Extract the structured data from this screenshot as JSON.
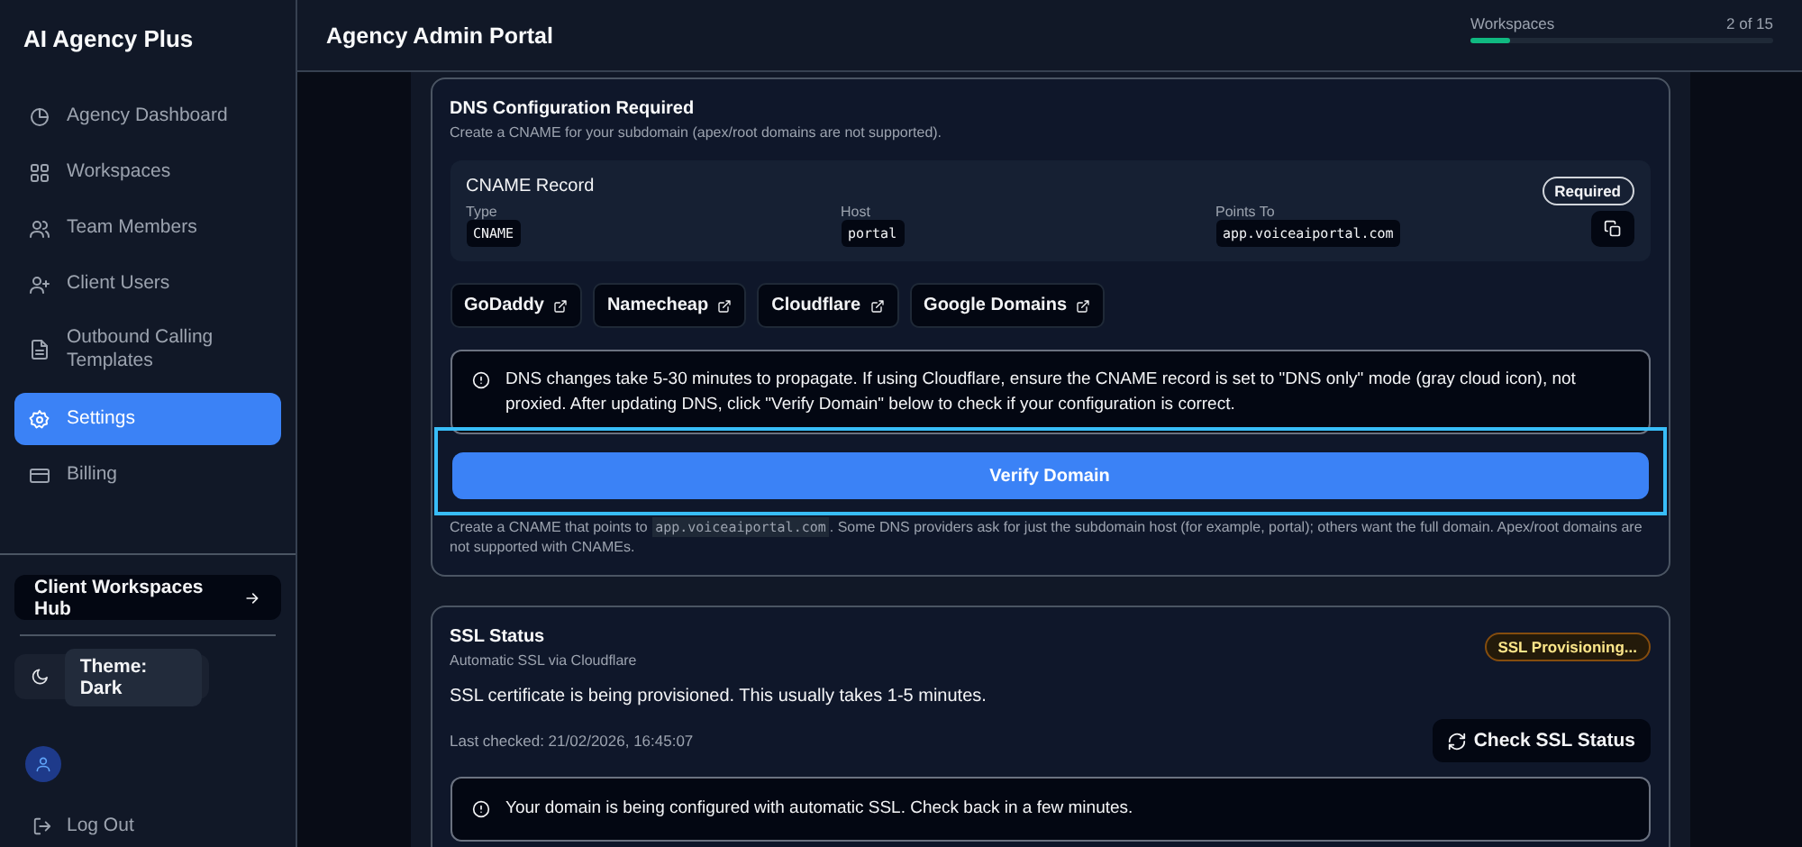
{
  "sidebar": {
    "brand": "AI Agency Plus",
    "items": [
      {
        "label": "Agency Dashboard",
        "selected": false
      },
      {
        "label": "Workspaces",
        "selected": false
      },
      {
        "label": "Team Members",
        "selected": false
      },
      {
        "label": "Client Users",
        "selected": false
      },
      {
        "label": "Outbound Calling Templates",
        "selected": false
      },
      {
        "label": "Settings",
        "selected": true
      },
      {
        "label": "Billing",
        "selected": false
      }
    ],
    "hub_button": "Client Workspaces Hub",
    "theme_toggle": "Theme: Dark",
    "logout": "Log Out"
  },
  "header": {
    "title": "Agency Admin Portal",
    "usage": {
      "label": "Workspaces",
      "count": "2 of 15",
      "level": 0.13
    }
  },
  "dns": {
    "title": "DNS Configuration Required",
    "subtitle": "Create a CNAME for your subdomain (apex/root domains are not supported).",
    "record": {
      "title": "CNAME Record",
      "badge": "Required",
      "fields": [
        {
          "label": "Type",
          "value": "CNAME"
        },
        {
          "label": "Host",
          "value": "portal"
        },
        {
          "label": "Points To",
          "value": "app.voiceaiportal.com"
        }
      ]
    },
    "providers": [
      "GoDaddy",
      "Namecheap",
      "Cloudflare",
      "Google Domains"
    ],
    "notice": "DNS changes take 5-30 minutes to propagate. If using Cloudflare, ensure the CNAME record is set to \"DNS only\" mode (gray cloud icon), not proxied. After updating DNS, click \"Verify Domain\" below to check if your configuration is correct.",
    "verify_button": {
      "label": "Verify Domain",
      "focused": true
    },
    "footnote": {
      "before": "Create a CNAME that points to",
      "code": "app.voiceaiportal.com",
      "after": ". Some DNS providers ask for just the subdomain host (for example, portal); others want the full domain. Apex/root domains are not supported with CNAMEs."
    }
  },
  "ssl": {
    "title": "SSL Status",
    "subtitle": "Automatic SSL via Cloudflare",
    "badge": "SSL Provisioning...",
    "message": "SSL certificate is being provisioned. This usually takes 1-5 minutes.",
    "last_checked": "Last checked: 21/02/2026, 16:45:07",
    "check_button": "Check SSL Status",
    "notice": "Your domain is being configured with automatic SSL. Check back in a few minutes."
  }
}
